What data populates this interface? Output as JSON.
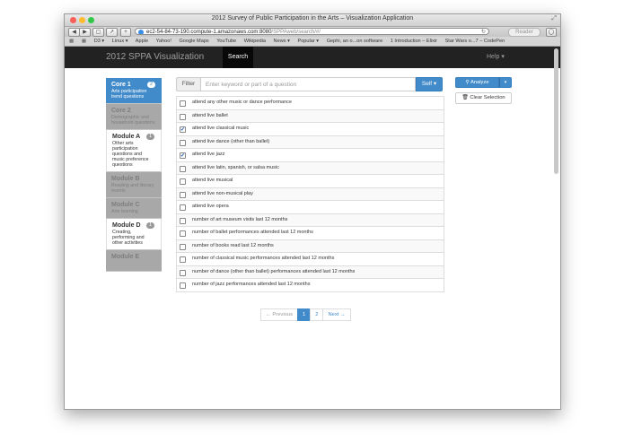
{
  "window": {
    "title": "2012 Survey of Public Participation in the Arts – Visualization Application",
    "url_host": "ec2-54-84-73-190.compute-1.amazonaws.com:8080",
    "url_path": "/SPPAweb/search/#/",
    "reader_label": "Reader",
    "traffic_colors": [
      "#fc5f57",
      "#fdbc2e",
      "#33c748"
    ]
  },
  "bookmarks": [
    "D3 ▾",
    "Linux ▾",
    "Apple",
    "Yahoo!",
    "Google Maps",
    "YouTube",
    "Wikipedia",
    "News ▾",
    "Popular ▾",
    "Gephi, an o...on software",
    "1 Introduction – Elixir",
    "Star Wars o...7 – CodePen"
  ],
  "navbar": {
    "brand": "2012 SPPA Visualization",
    "search": "Search",
    "help": "Help ▾"
  },
  "sidebar": {
    "items": [
      {
        "title": "Core 1",
        "desc": "Arts participation trend questions",
        "badge": "2",
        "state": "active"
      },
      {
        "title": "Core 2",
        "desc": "Demographic and household questions",
        "badge": "",
        "state": "gray"
      },
      {
        "title": "Module A",
        "desc": "Other arts participation questions and music preference questions",
        "badge": "1",
        "state": "white"
      },
      {
        "title": "Module B",
        "desc": "Reading and literary events",
        "badge": "",
        "state": "gray"
      },
      {
        "title": "Module C",
        "desc": "Arts learning",
        "badge": "",
        "state": "gray"
      },
      {
        "title": "Module D",
        "desc": "Creating, performing and other activities",
        "badge": "1",
        "state": "white"
      },
      {
        "title": "Module E",
        "desc": "",
        "badge": "",
        "state": "gray"
      }
    ]
  },
  "filter": {
    "label": "Filter",
    "placeholder": "Enter keyword or part of a question",
    "value": "",
    "scope": "Self ▾"
  },
  "questions": [
    {
      "label": "attend any other music or dance performance",
      "checked": false
    },
    {
      "label": "attend live ballet",
      "checked": false
    },
    {
      "label": "attend live classical music",
      "checked": true
    },
    {
      "label": "attend live dance (other than ballet)",
      "checked": false
    },
    {
      "label": "attend live jazz",
      "checked": true
    },
    {
      "label": "attend live latin, spanish, or salsa music",
      "checked": false
    },
    {
      "label": "attend live musical",
      "checked": false
    },
    {
      "label": "attend live non-musical play",
      "checked": false
    },
    {
      "label": "attend live opera",
      "checked": false
    },
    {
      "label": "number of art museum visits last 12 months",
      "checked": false
    },
    {
      "label": "number of ballet performances attended last 12 months",
      "checked": false
    },
    {
      "label": "number of books read last 12 months",
      "checked": false
    },
    {
      "label": "number of classical music performances attended last 12 months",
      "checked": false
    },
    {
      "label": "number of dance (other than ballet) performances attended last 12 months",
      "checked": false
    },
    {
      "label": "number of jazz performances attended last 12 months",
      "checked": false
    }
  ],
  "actions": {
    "analyze": "Analyze",
    "analyze_icon": "search-icon",
    "caret": "▾",
    "clear": "Clear Selection",
    "clear_icon": "trash-icon"
  },
  "pagination": {
    "previous": "← Previous",
    "pages": [
      "1",
      "2"
    ],
    "active_page": "1",
    "next": "Next →"
  },
  "colors": {
    "primary": "#428bca",
    "navbar": "#222222"
  }
}
